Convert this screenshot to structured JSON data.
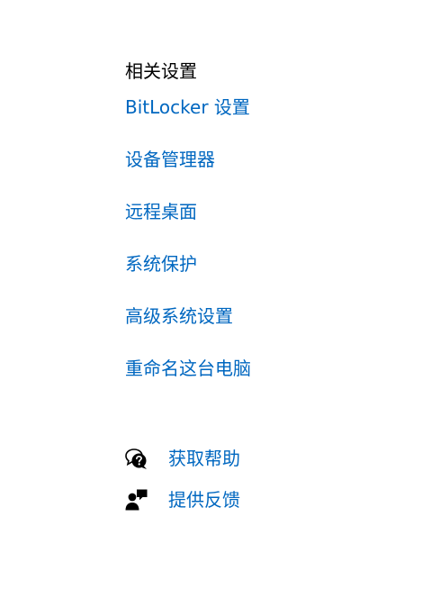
{
  "related_settings": {
    "title": "相关设置",
    "links": [
      {
        "label": "BitLocker 设置"
      },
      {
        "label": "设备管理器"
      },
      {
        "label": "远程桌面"
      },
      {
        "label": "系统保护"
      },
      {
        "label": "高级系统设置"
      },
      {
        "label": "重命名这台电脑"
      }
    ]
  },
  "help": {
    "get_help": {
      "label": "获取帮助",
      "icon": "chat-help-icon"
    },
    "feedback": {
      "label": "提供反馈",
      "icon": "feedback-icon"
    }
  },
  "colors": {
    "link": "#0067c0",
    "title": "#000000",
    "background": "#ffffff"
  }
}
